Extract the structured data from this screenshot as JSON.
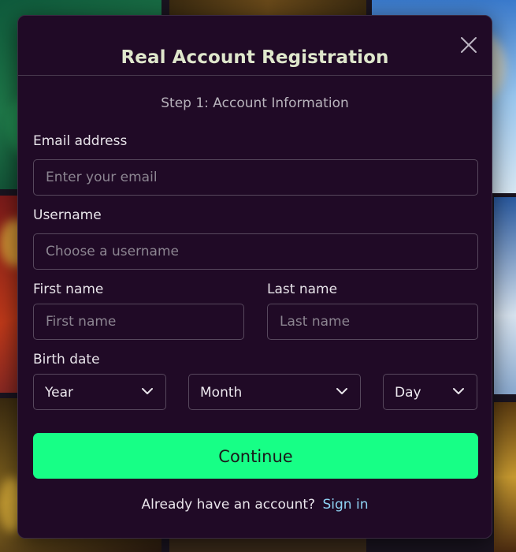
{
  "modal": {
    "title": "Real Account Registration",
    "close_icon": "close-icon"
  },
  "step_label": "Step 1: Account Information",
  "form": {
    "email": {
      "label": "Email address",
      "placeholder": "Enter your email",
      "value": ""
    },
    "username": {
      "label": "Username",
      "placeholder": "Choose a username",
      "value": ""
    },
    "first_name": {
      "label": "First name",
      "placeholder": "First name",
      "value": ""
    },
    "last_name": {
      "label": "Last name",
      "placeholder": "Last name",
      "value": ""
    },
    "birth_date": {
      "label": "Birth date",
      "year": {
        "selected": "Year",
        "icon": "chevron-down-icon"
      },
      "month": {
        "selected": "Month",
        "icon": "chevron-down-icon"
      },
      "day": {
        "selected": "Day",
        "icon": "chevron-down-icon"
      }
    }
  },
  "continue_label": "Continue",
  "signin": {
    "prompt": "Already have an account?",
    "link": "Sign in"
  },
  "colors": {
    "modal_bg": "#200a26",
    "accent_button": "#17ff86",
    "link": "#8fd3f4",
    "title": "#dfe7cc"
  }
}
